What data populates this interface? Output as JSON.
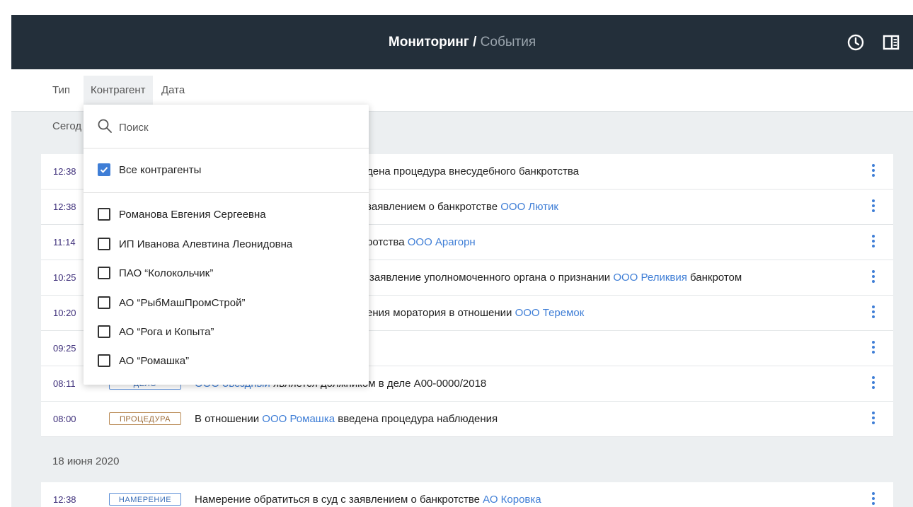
{
  "header": {
    "title_main": "Мониторинг",
    "title_sep": "/",
    "title_sub": "События"
  },
  "filters": {
    "tabs": [
      {
        "label": "Тип",
        "active": false
      },
      {
        "label": "Контрагент",
        "active": true
      },
      {
        "label": "Дата",
        "active": false
      }
    ]
  },
  "dropdown": {
    "search_placeholder": "Поиск",
    "all_label": "Все контрагенты",
    "all_checked": true,
    "options": [
      "Романова Евгения Сергеевна",
      "ИП Иванова Алевтина Леонидовна",
      "ПАО “Колокольчик”",
      "АО “РыбМашПромСтрой”",
      "АО “Рога и Копыта”",
      "АО “Ромашка”"
    ]
  },
  "sections": [
    {
      "label": "Сегодня",
      "label_visible": "Сегод",
      "rows": [
        {
          "time": "12:38",
          "badge": "",
          "text": [
            "дена процедура внесудебного банкротства"
          ],
          "link": "",
          "after": ""
        },
        {
          "time": "12:38",
          "badge": "",
          "text": [
            "заявлением о банкротстве "
          ],
          "link": "ООО Лютик",
          "after": ""
        },
        {
          "time": "11:14",
          "badge": "",
          "text": [
            "ротства "
          ],
          "link": "ООО Арагорн",
          "after": ""
        },
        {
          "time": "10:25",
          "badge": "",
          "text": [
            "заявление уполномоченного органа о признании "
          ],
          "link": "ООО Реликвия",
          "after": " банкротом"
        },
        {
          "time": "10:20",
          "badge": "",
          "text": [
            "ения моратория в отношении "
          ],
          "link": "ООО Теремок",
          "after": ""
        },
        {
          "time": "09:25",
          "badge": "",
          "text": [
            ""
          ],
          "link": "",
          "after": ""
        },
        {
          "time": "08:11",
          "badge": "ДЕЛО",
          "text": [
            ""
          ],
          "link": "ООО Звездный",
          "after": " является должником в деле А00-0000/2018"
        },
        {
          "time": "08:00",
          "badge": "ПРОЦЕДУРА",
          "text": [
            "В отношении "
          ],
          "link": "ООО Ромашка",
          "after": " введена процедура наблюдения"
        }
      ]
    },
    {
      "label": "18 июня 2020",
      "rows": [
        {
          "time": "12:38",
          "badge": "НАМЕРЕНИЕ",
          "text": [
            "Намерение обратиться в суд с заявлением о банкротстве "
          ],
          "link": "АО Коровка",
          "after": ""
        }
      ]
    }
  ],
  "colors": {
    "header_bg": "#232f3a",
    "accent": "#3f7ed6",
    "badge_blue": "#3b6fb8",
    "badge_brown": "#9b6a36"
  }
}
